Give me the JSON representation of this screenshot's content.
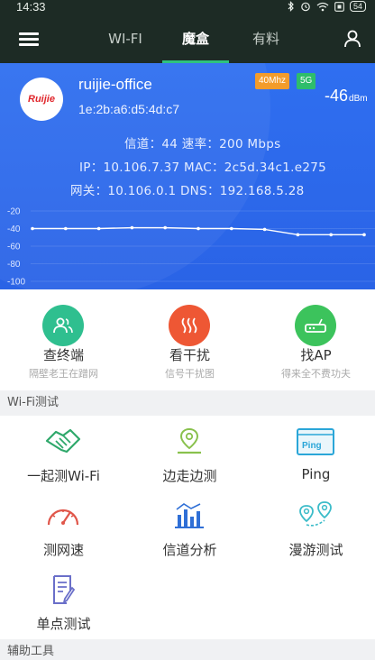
{
  "status_bar": {
    "time": "14:33",
    "battery": "54"
  },
  "nav": {
    "tabs": [
      {
        "label": "WI-FI"
      },
      {
        "label": "魔盒"
      },
      {
        "label": "有料"
      }
    ],
    "active_tab": "魔盒"
  },
  "wifi": {
    "ssid": "ruijie-office",
    "bssid": "1e:2b:a6:d5:4d:c7",
    "logo_text": "Ruijie",
    "channel_width": "40Mhz",
    "band": "5G",
    "signal_value": "-46",
    "signal_unit": "dBm",
    "info_line1": "信道：44  速率：200 Mbps",
    "info_line2": "IP：10.106.7.37  MAC：2c5d.34c1.e275",
    "info_line3": "网关：10.106.0.1  DNS：192.168.5.28"
  },
  "chart_data": {
    "type": "line",
    "y_ticks": [
      "-20",
      "-40",
      "-60",
      "-80",
      "-100"
    ],
    "ylim": [
      -110,
      -20
    ],
    "series": [
      {
        "values": [
          -40,
          -40,
          -40,
          -39,
          -39,
          -40,
          -40,
          -41,
          -47,
          -47,
          -47
        ]
      }
    ],
    "grid": true
  },
  "quick_actions": [
    {
      "title": "查终端",
      "subtitle": "隔壁老王在蹭网",
      "color": "#2fbf8f"
    },
    {
      "title": "看干扰",
      "subtitle": "信号干扰图",
      "color": "#ee5734"
    },
    {
      "title": "找AP",
      "subtitle": "得来全不费功夫",
      "color": "#3cc35c"
    }
  ],
  "sections": {
    "wifi_test": "Wi-Fi测试",
    "aux_tools": "辅助工具"
  },
  "tools": [
    {
      "label": "一起测Wi-Fi",
      "icon": "handshake-icon"
    },
    {
      "label": "边走边测",
      "icon": "location-pin-icon"
    },
    {
      "label": "Ping",
      "icon": "ping-window-icon",
      "icon_text": "Ping"
    },
    {
      "label": "测网速",
      "icon": "speedometer-icon"
    },
    {
      "label": "信道分析",
      "icon": "bar-chart-icon"
    },
    {
      "label": "漫游测试",
      "icon": "roaming-icon"
    },
    {
      "label": "单点测试",
      "icon": "document-edit-icon"
    }
  ]
}
